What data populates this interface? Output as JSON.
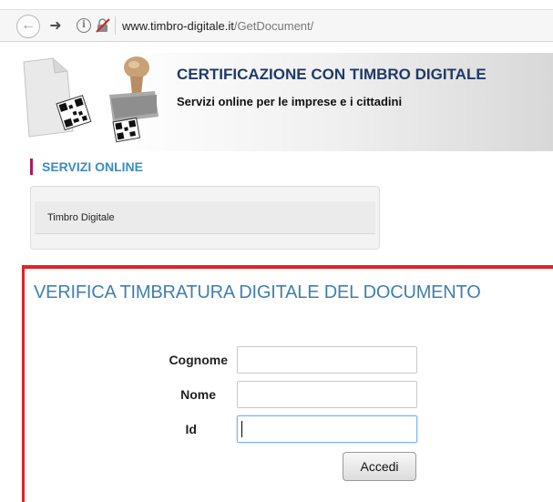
{
  "browser": {
    "url_host": "www.timbro-digitale.it",
    "url_path": "/GetDocument/",
    "back_icon": "back-arrow-icon",
    "forward_icon": "forward-arrow-icon",
    "info_icon": "info-icon",
    "insecure_icon": "insecure-connection-icon"
  },
  "header": {
    "title": "CERTIFICAZIONE CON TIMBRO DIGITALE",
    "subtitle": "Servizi online per le imprese e i cittadini",
    "logo_icon": "document-stamp-qr-logo"
  },
  "services": {
    "heading": "SERVIZI ONLINE",
    "items": [
      {
        "label": "Timbro Digitale"
      }
    ]
  },
  "verify": {
    "title": "VERIFICA TIMBRATURA DIGITALE DEL DOCUMENTO",
    "fields": {
      "cognome": {
        "label": "Cognome",
        "value": ""
      },
      "nome": {
        "label": "Nome",
        "value": ""
      },
      "id": {
        "label": "Id",
        "value": ""
      }
    },
    "submit_label": "Accedi"
  },
  "colors": {
    "accent_red": "#e0232b",
    "title_blue": "#3f7fb0",
    "heading_blue": "#3b8cc4",
    "header_navy": "#1f3a66",
    "heading_marker": "#b3175a"
  }
}
